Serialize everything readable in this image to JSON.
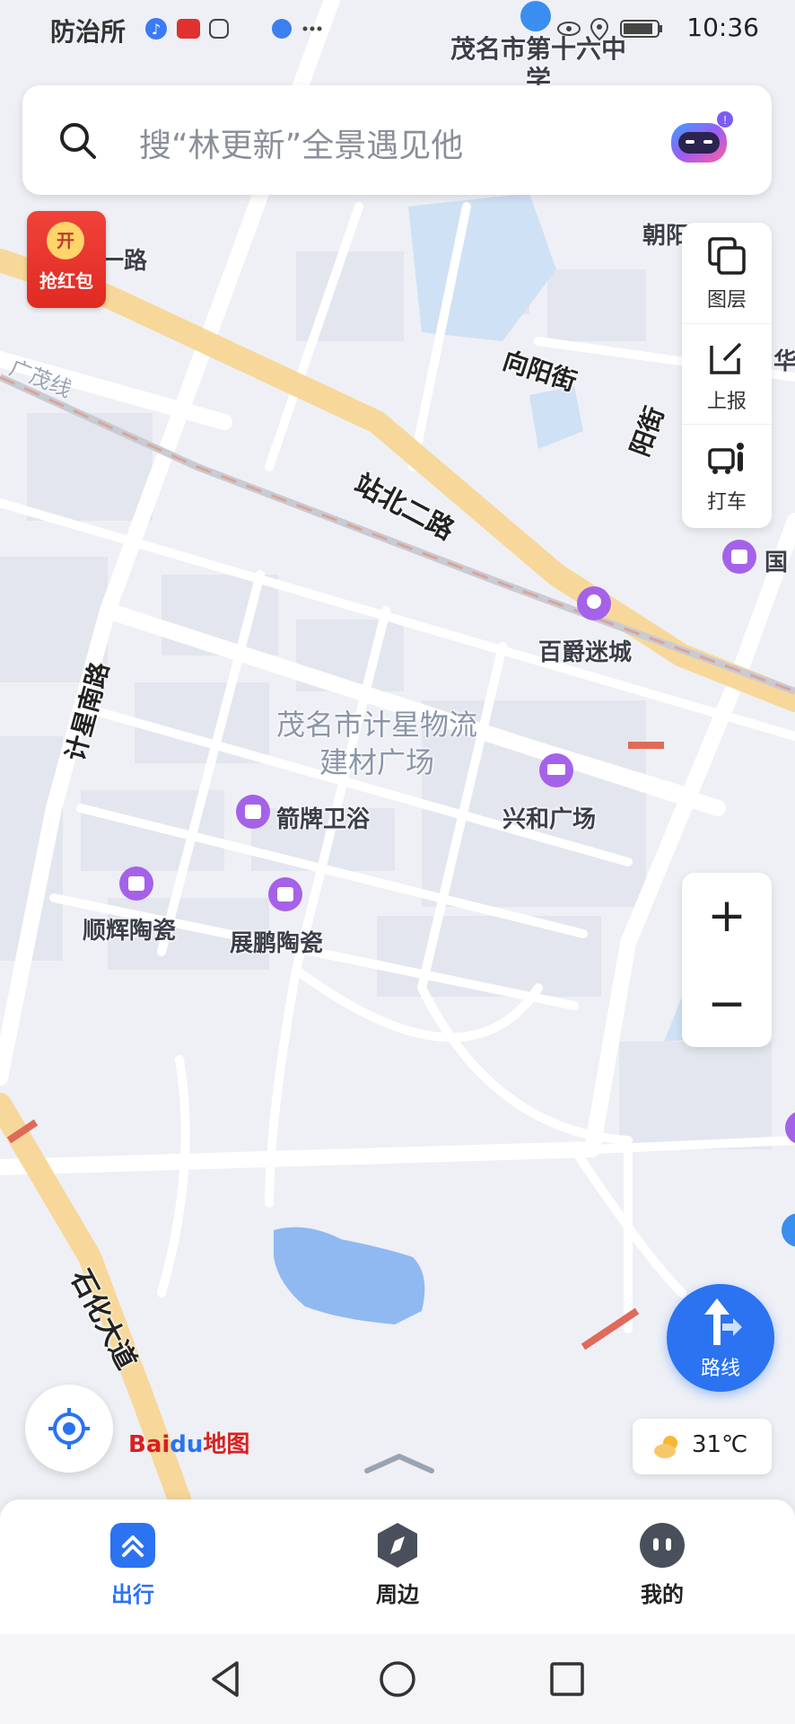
{
  "status_bar": {
    "left_text": "防治所",
    "time": "10:36",
    "overlay_text": "茂名市第十六中学"
  },
  "search": {
    "placeholder": "搜“林更新”全景遇见他"
  },
  "red_packet": {
    "coin": "开",
    "label": "抢红包"
  },
  "tools": [
    {
      "icon": "layers-icon",
      "label": "图层"
    },
    {
      "icon": "report-icon",
      "label": "上报"
    },
    {
      "icon": "taxi-icon",
      "label": "打车"
    }
  ],
  "zoom": {
    "in": "+",
    "out": "−"
  },
  "route_button": {
    "label": "路线"
  },
  "logo": {
    "bai": "Bai",
    "du": "du",
    "map": "地图"
  },
  "weather": {
    "temp": "31℃",
    "icon": "partly-sunny-icon"
  },
  "bottom_nav": [
    {
      "label": "出行",
      "icon": "travel-icon",
      "active": true
    },
    {
      "label": "周边",
      "icon": "compass-icon",
      "active": false
    },
    {
      "label": "我的",
      "icon": "profile-icon",
      "active": false
    }
  ],
  "map_labels": {
    "school": "茂名市第十六中学",
    "chaoyang": "朝阳",
    "road_1": "一路",
    "guangmao_line": "广茂线",
    "xiangyang_st": "向阳街",
    "yang_st": "阳街",
    "hua": "华",
    "zhanbei_2": "站北二路",
    "guo": "国",
    "baijue": "百爵迷城",
    "jixing_south": "计星南路",
    "logistics_area": "茂名市计星物流建材广场",
    "xinghe": "兴和广场",
    "jianpai": "箭牌卫浴",
    "shunhui": "顺辉陶瓷",
    "zhanpeng": "展鹏陶瓷",
    "shihua": "石化大道"
  },
  "colors": {
    "accent": "#2b73f0",
    "major_road": "#f7d89a",
    "poi_purple": "#a562e8",
    "water": "#8fb9f0"
  }
}
